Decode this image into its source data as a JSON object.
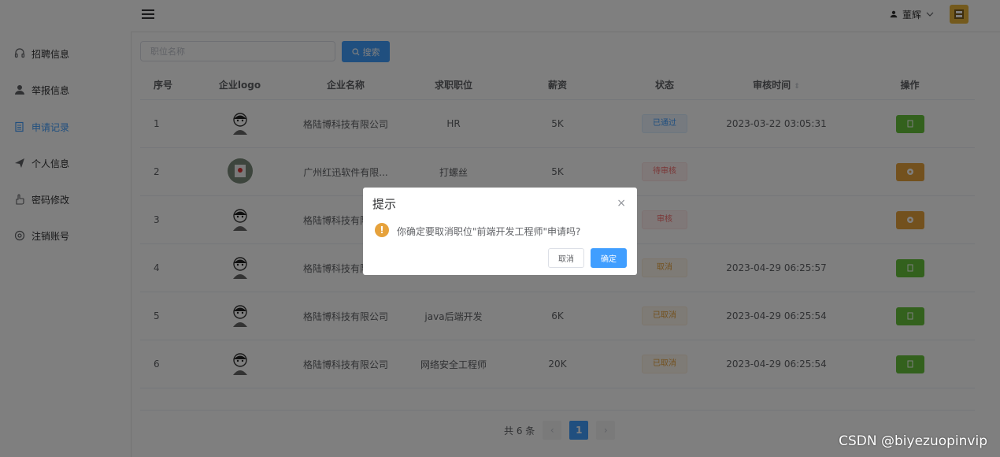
{
  "sidebar": {
    "items": [
      {
        "label": "招聘信息",
        "icon": "headset-icon"
      },
      {
        "label": "举报信息",
        "icon": "user-icon"
      },
      {
        "label": "申请记录",
        "icon": "document-icon",
        "active": true
      },
      {
        "label": "个人信息",
        "icon": "send-icon"
      },
      {
        "label": "密码修改",
        "icon": "hand-icon"
      },
      {
        "label": "注销账号",
        "icon": "settings-icon"
      }
    ]
  },
  "header": {
    "user_name": "董辉"
  },
  "search": {
    "placeholder": "职位名称",
    "button_label": "搜索"
  },
  "table": {
    "columns": [
      "序号",
      "企业logo",
      "企业名称",
      "求职职位",
      "薪资",
      "状态",
      "审核时间",
      "操作"
    ],
    "rows": [
      {
        "index": "1",
        "company": "格陆博科技有限公司",
        "position": "HR",
        "salary": "5K",
        "status": "已通过",
        "status_type": "pass",
        "time": "2023-03-22 03:05:31",
        "op": "green"
      },
      {
        "index": "2",
        "company": "广州红迅软件有限...",
        "position": "打螺丝",
        "salary": "5K",
        "status": "待审核",
        "status_type": "wait",
        "time": "",
        "op": "orange"
      },
      {
        "index": "3",
        "company": "格陆博科技有限公司",
        "position": "",
        "salary": "",
        "status": "审核",
        "status_type": "wait",
        "time": "",
        "op": "orange"
      },
      {
        "index": "4",
        "company": "格陆博科技有限公司",
        "position": "",
        "salary": "",
        "status": "取消",
        "status_type": "cancel",
        "time": "2023-04-29 06:25:57",
        "op": "green"
      },
      {
        "index": "5",
        "company": "格陆博科技有限公司",
        "position": "java后端开发",
        "salary": "6K",
        "status": "已取消",
        "status_type": "cancel",
        "time": "2023-04-29 06:25:54",
        "op": "green"
      },
      {
        "index": "6",
        "company": "格陆博科技有限公司",
        "position": "网络安全工程师",
        "salary": "20K",
        "status": "已取消",
        "status_type": "cancel",
        "time": "2023-04-29 06:25:54",
        "op": "green"
      }
    ]
  },
  "pagination": {
    "total": "共 6 条",
    "current": "1",
    "prev": "‹",
    "next": "›"
  },
  "dialog": {
    "title": "提示",
    "message": "你确定要取消职位\"前端开发工程师\"申请吗?",
    "cancel": "取消",
    "confirm": "确定",
    "close": "×",
    "warning": "!"
  },
  "watermark": "CSDN @biyezuopinvip",
  "colors": {
    "primary": "#409eff",
    "success": "#67c23a",
    "warning": "#e6a23c",
    "danger": "#f56c6c"
  }
}
